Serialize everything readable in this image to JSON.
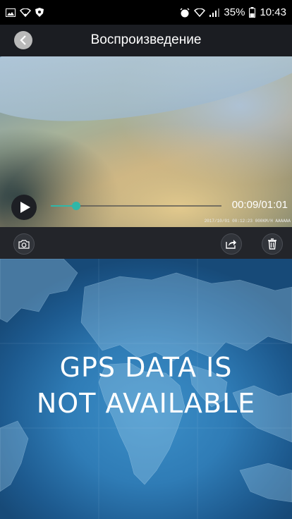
{
  "status_bar": {
    "battery_percent": "35%",
    "time": "10:43"
  },
  "header": {
    "title": "Воспроизведение"
  },
  "player": {
    "time_display": "00:09/01:01",
    "progress_fraction": 0.15,
    "overlay_stamp": "2017/10/01 00:12:23 000KM/H AAAAAA",
    "accent_color": "#2fb7a8"
  },
  "toolbar": {
    "icons": [
      "camera-icon",
      "share-icon",
      "trash-icon"
    ]
  },
  "map": {
    "message_line1": "GPS data is",
    "message_line2": "not available"
  }
}
